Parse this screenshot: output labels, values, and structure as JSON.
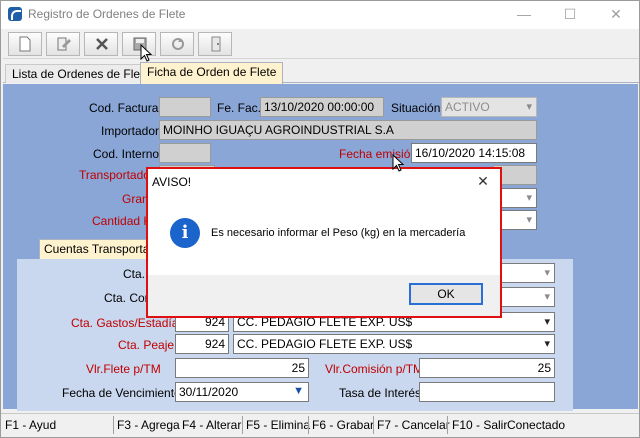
{
  "window": {
    "title": "Registro de Ordenes de Flete",
    "min_glyph": "—",
    "max_glyph": "☐",
    "close_glyph": "✕"
  },
  "toolbar": {
    "buttons": [
      "new-document-icon",
      "edit-document-icon",
      "delete-icon",
      "save-icon",
      "refresh-icon",
      "exit-icon"
    ]
  },
  "tabs": [
    {
      "label": "Lista de Ordenes de Flete",
      "active": false
    },
    {
      "label": "Ficha de Orden de Flete",
      "active": true
    }
  ],
  "form": {
    "cod_factura_label": "Cod. Factura",
    "cod_factura_value": "",
    "fe_fac_label": "Fe. Fac.",
    "fe_fac_value": "13/10/2020 00:00:00",
    "situacion_label": "Situación",
    "situacion_value": "ACTIVO",
    "importador_label": "Importador",
    "importador_value": "MOINHO IGUAÇU AGROINDUSTRIAL S.A",
    "cod_interno_label": "Cod. Interno",
    "cod_interno_value": "",
    "fecha_emision_label": "Fecha emisión",
    "fecha_emision_value": "16/10/2020 14:15:08",
    "transportadora_label": "Transportador",
    "grano_label": "Gran",
    "cantidad_label": "Cantidad K"
  },
  "subtab": {
    "label": "Cuentas Transportad"
  },
  "cuentas": {
    "cta_1_label": "Cta.",
    "cta_comision_label": "Cta. Com",
    "cta_gastos_label": "Cta. Gastos/Estadía",
    "cta_gastos_code": "924",
    "cta_gastos_value": "CC. PEDAGIO FLETE EXP. US$",
    "cta_peaje_label": "Cta. Peaje",
    "cta_peaje_code": "924",
    "cta_peaje_value": "CC. PEDAGIO FLETE EXP. US$",
    "vlr_flete_label": "Vlr.Flete p/TM",
    "vlr_flete_value": "25",
    "vlr_comision_label": "Vlr.Comisión p/TM",
    "vlr_comision_value": "25",
    "fecha_venc_label": "Fecha de Vencimiento",
    "fecha_venc_value": "30/11/2020",
    "tasa_label": "Tasa de Interés",
    "tasa_value": ""
  },
  "statusbar": {
    "items": [
      "F1 - Ayud",
      "F3 - Agrega",
      "F4 - Alterar",
      "F5 - Elimina",
      "F6 - Grabar",
      "F7 - Cancelar",
      "F10 - Salir",
      "Conectado"
    ]
  },
  "dialog": {
    "title": "AVISO!",
    "close_glyph": "✕",
    "icon_glyph": "i",
    "message": "Es necesario informar el Peso (kg) en la mercadería",
    "ok_label": "OK"
  },
  "colors": {
    "form_background": "#8aa6d6",
    "dialog_border": "#e01010",
    "info_icon": "#1a64cc",
    "required_label": "#c00000"
  }
}
